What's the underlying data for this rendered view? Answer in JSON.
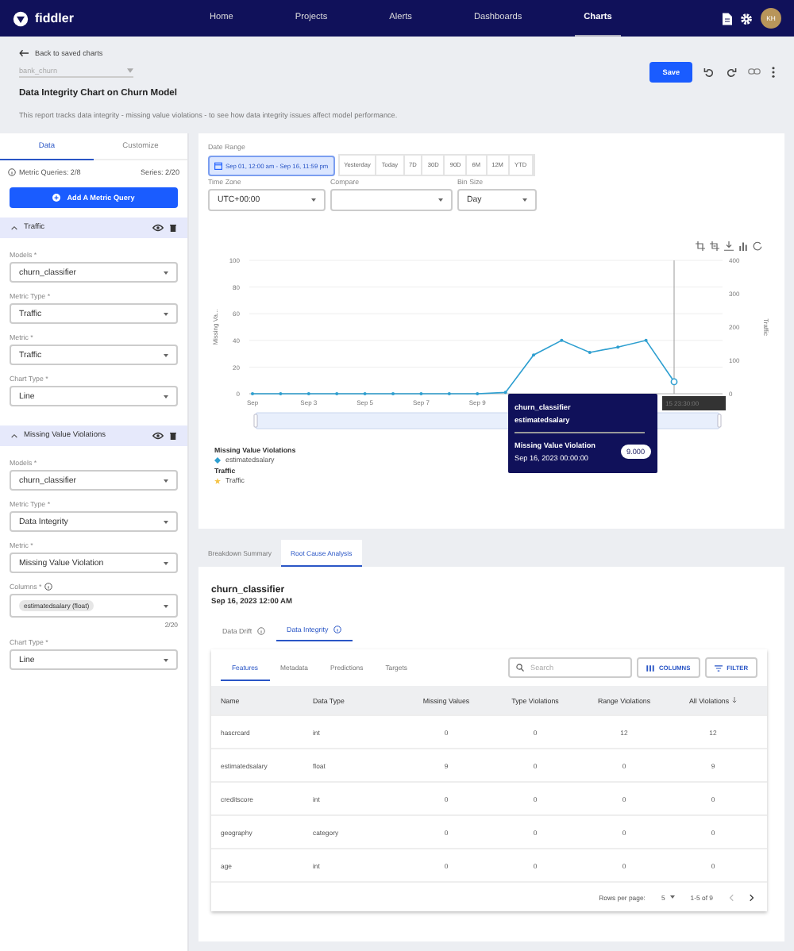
{
  "header": {
    "logo": "fiddler",
    "nav": [
      {
        "label": "Home",
        "selected": false
      },
      {
        "label": "Projects",
        "selected": false
      },
      {
        "label": "Alerts",
        "selected": false
      },
      {
        "label": "Dashboards",
        "selected": false
      },
      {
        "label": "Charts",
        "selected": true
      }
    ],
    "avatar": "KH"
  },
  "toolbar": {
    "back": "Back to saved charts",
    "project": "bank_churn",
    "title": "Data Integrity Chart on Churn Model",
    "description": "This report tracks data integrity - missing value violations - to see how data integrity issues affect model performance.",
    "save": "Save"
  },
  "sidebar": {
    "tabs": [
      {
        "label": "Data",
        "selected": true
      },
      {
        "label": "Customize",
        "selected": false
      }
    ],
    "metric_queries": "Metric Queries: 2/8",
    "series": "Series: 2/20",
    "add_button": "Add A Metric Query",
    "queries": [
      {
        "title": "Traffic",
        "expanded": true,
        "fields": [
          {
            "kind": "select",
            "label": "Models *",
            "value": "churn_classifier"
          },
          {
            "kind": "select",
            "label": "Metric Type *",
            "value": "Traffic"
          },
          {
            "kind": "select",
            "label": "Metric *",
            "value": "Traffic"
          },
          {
            "kind": "select",
            "label": "Chart Type *",
            "value": "Line"
          }
        ]
      },
      {
        "title": "Missing Value Violations",
        "expanded": true,
        "fields": [
          {
            "kind": "select",
            "label": "Models *",
            "value": "churn_classifier"
          },
          {
            "kind": "select",
            "label": "Metric Type *",
            "value": "Data Integrity"
          },
          {
            "kind": "select",
            "label": "Metric *",
            "value": "Missing Value Violation"
          },
          {
            "kind": "chips",
            "label": "Columns *",
            "value": "estimatedsalary (float)",
            "count": "2/20"
          },
          {
            "kind": "select",
            "label": "Chart Type *",
            "value": "Line"
          }
        ]
      }
    ]
  },
  "chart": {
    "date_range": {
      "label": "Date Range",
      "value": "Sep 01, 12:00 am - Sep 16, 11:59 pm",
      "presets": [
        "Yesterday",
        "Today",
        "7D",
        "30D",
        "90D",
        "6M",
        "12M",
        "YTD"
      ]
    },
    "selects": [
      {
        "label": "Time Zone",
        "value": "UTC+00:00"
      },
      {
        "label": "Compare"
      },
      {
        "label": "Bin Size",
        "value": "Day"
      }
    ],
    "chart_data": {
      "type": "line",
      "ylabel": "Missing Va...",
      "categories": [
        "Sep",
        null,
        "Sep 3",
        null,
        "Sep 5",
        null,
        "Sep 7",
        null,
        "Sep 9",
        null,
        null,
        null,
        null,
        null,
        null,
        null
      ],
      "ylim": [
        0,
        100
      ],
      "grid": true,
      "yticks": [
        0,
        20,
        40,
        60,
        80,
        100
      ],
      "series": [
        {
          "name": "estimatedsalary",
          "color": "#2e9fd0",
          "values": [
            0,
            0,
            0,
            0,
            0,
            0,
            0,
            0,
            0,
            1,
            29,
            40,
            31,
            35,
            40,
            9
          ]
        },
        {
          "name": "Traffic",
          "color": "#f5c242",
          "values": [
            null,
            null,
            null,
            null,
            null,
            null,
            null,
            null,
            null,
            null,
            null,
            null,
            null,
            null,
            null,
            null
          ]
        }
      ]
    },
    "right_axis": {
      "title": "Traffic",
      "ticks": [
        "400",
        "300",
        "200",
        "100",
        "0"
      ]
    },
    "crosshair_label": "15 23:30:00",
    "tooltip": {
      "model": "churn_classifier",
      "column": "estimatedsalary",
      "metric": "Missing Value Violation",
      "time": "Sep 16, 2023 00:00:00",
      "value": "9.000"
    },
    "legend": [
      {
        "group": "Missing Value Violations",
        "kind": "diamond"
      },
      {
        "group": "Traffic",
        "kind": "star"
      }
    ]
  },
  "analysis_tabs": [
    {
      "label": "Breakdown Summary",
      "selected": false
    },
    {
      "label": "Root Cause Analysis",
      "selected": true
    }
  ],
  "rca": {
    "model": "churn_classifier",
    "date": "Sep 16, 2023 12:00 AM",
    "tabs": [
      {
        "label": "Data Drift",
        "selected": false
      },
      {
        "label": "Data Integrity",
        "selected": true
      }
    ],
    "table_tabs": [
      {
        "label": "Features",
        "selected": true
      },
      {
        "label": "Metadata",
        "selected": false
      },
      {
        "label": "Predictions",
        "selected": false
      },
      {
        "label": "Targets",
        "selected": false
      }
    ],
    "search": {
      "placeholder": "Search"
    },
    "columns_button": "COLUMNS",
    "filter_button": "FILTER",
    "table": {
      "columns": [
        {
          "label": "Name",
          "sorted": false
        },
        {
          "label": "Data Type",
          "sorted": false
        },
        {
          "label": "Missing Values",
          "sorted": false
        },
        {
          "label": "Type Violations",
          "sorted": false
        },
        {
          "label": "Range Violations",
          "sorted": false
        },
        {
          "label": "All Violations",
          "sorted": true
        }
      ],
      "rows": [
        [
          "hascrcard",
          "int",
          "0",
          "0",
          "12",
          "12"
        ],
        [
          "estimatedsalary",
          "float",
          "9",
          "0",
          "0",
          "9"
        ],
        [
          "creditscore",
          "int",
          "0",
          "0",
          "0",
          "0"
        ],
        [
          "geography",
          "category",
          "0",
          "0",
          "0",
          "0"
        ],
        [
          "age",
          "int",
          "0",
          "0",
          "0",
          "0"
        ]
      ]
    },
    "footer": {
      "rows_per_page": "Rows per page:",
      "page_size": "5",
      "range": "1-5 of 9"
    }
  }
}
